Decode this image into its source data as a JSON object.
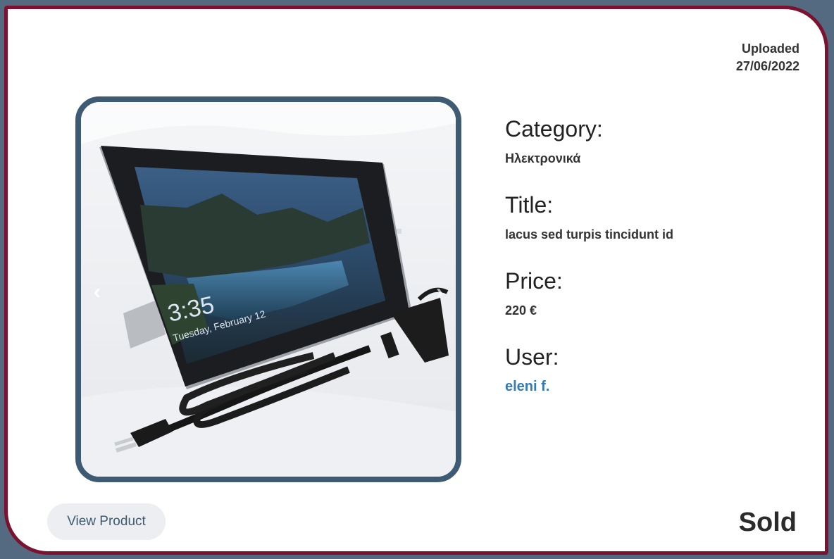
{
  "product": {
    "uploaded_label": "Uploaded",
    "uploaded_date": "27/06/2022",
    "category_label": "Category:",
    "category_value": "Ηλεκτρονικά",
    "title_label": "Title:",
    "title_value": "lacus sed turpis tincidunt id",
    "price_label": "Price:",
    "price_value": "220 €",
    "user_label": "User:",
    "user_value": "eleni f.",
    "status": "Sold"
  },
  "carousel": {
    "prev_icon": "‹",
    "next_icon": "›",
    "screen_time": "3:35",
    "screen_date": "Tuesday, February 12"
  },
  "actions": {
    "view_product_label": "View Product"
  },
  "colors": {
    "card_border": "#7a1230",
    "image_border": "#3f5a73",
    "link": "#337ab7",
    "background": "#536a80"
  }
}
